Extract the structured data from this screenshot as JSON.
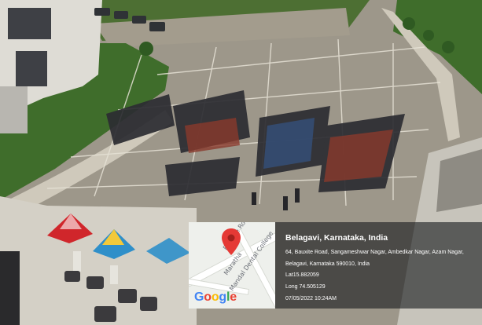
{
  "photo": {
    "scene": "aerial-parade-ground",
    "colors": {
      "ground": "#a6a091",
      "lawn": "#3f6d2b",
      "building": "#dcdcd6",
      "tent_red": "#d0262b",
      "tent_blue": "#2f8fc9"
    }
  },
  "geotag": {
    "map": {
      "streets": [
        "Bauxite Road",
        "Maratha",
        "Mandal Dental College"
      ],
      "logo": "Google",
      "pin_icon": "map-pin-icon"
    },
    "title": "Belagavi, Karnataka, India",
    "address_line1": "64, Bauxite Road, Sangameshwar Nagar, Ambedkar Nagar, Azam Nagar,",
    "address_line2": "Belagavi, Karnataka 590010, India",
    "latitude": "Lat15.882059",
    "longitude": "Long 74.505129",
    "datetime": "07/05/2022 10:24AM"
  }
}
